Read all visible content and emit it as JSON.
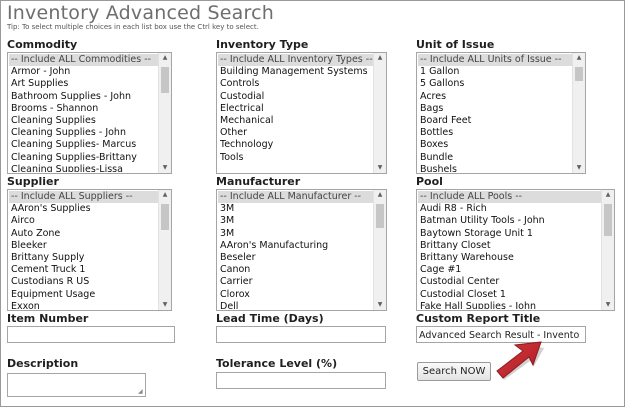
{
  "page": {
    "title": "Inventory Advanced Search",
    "tip": "Tip: To select multiple choices in each list box use the Ctrl key to select."
  },
  "lists": {
    "commodity": {
      "label": "Commodity",
      "options": [
        "-- Include ALL Commodities --",
        "Armor - John",
        "Art Supplies",
        "Bathroom Supplies - John",
        "Brooms - Shannon",
        "Cleaning Supplies",
        "Cleaning Supplies - John",
        "Cleaning Supplies- Marcus",
        "Cleaning Supplies-Brittany",
        "Cleaning Supplies-Lissa"
      ]
    },
    "inventory_type": {
      "label": "Inventory Type",
      "options": [
        "-- Include ALL Inventory Types --",
        "Building Management Systems",
        "Controls",
        "Custodial",
        "Electrical",
        "Mechanical",
        "Other",
        "Technology",
        "Tools"
      ]
    },
    "unit_of_issue": {
      "label": "Unit of Issue",
      "options": [
        "-- Include ALL Units of Issue --",
        "1 Gallon",
        "5 Gallons",
        "Acres",
        "Bags",
        "Board Feet",
        "Bottles",
        "Boxes",
        "Bundle",
        "Bushels"
      ]
    },
    "supplier": {
      "label": "Supplier",
      "options": [
        "-- Include ALL Suppliers --",
        "AAron's Supplies",
        "Airco",
        "Auto Zone",
        "Bleeker",
        "Brittany Supply",
        "Cement Truck 1",
        "Custodians R US",
        "Equipment Usage",
        "Exxon"
      ]
    },
    "manufacturer": {
      "label": "Manufacturer",
      "options": [
        "-- Include ALL Manufacturer --",
        "3M",
        "3M",
        "3M",
        "AAron's Manufacturing",
        "Beseler",
        "Canon",
        "Carrier",
        "Clorox",
        "Dell"
      ]
    },
    "pool": {
      "label": "Pool",
      "options": [
        "-- Include ALL Pools --",
        "Audi R8 - Rich",
        "Batman Utility Tools - John",
        "Baytown Storage Unit 1",
        "Brittany Closet",
        "Brittany Warehouse",
        "Cage #1",
        "Custodial Center",
        "Custodial Closet 1",
        "Fake Hall Supplies - John"
      ]
    }
  },
  "fields": {
    "item_number": {
      "label": "Item Number",
      "value": ""
    },
    "lead_time": {
      "label": "Lead Time (Days)",
      "value": ""
    },
    "custom_report_title": {
      "label": "Custom Report Title",
      "value": "Advanced Search Result - Invento"
    },
    "description": {
      "label": "Description",
      "value": ""
    },
    "tolerance_level": {
      "label": "Tolerance Level (%)",
      "value": ""
    }
  },
  "search_button": {
    "label": "Search NOW"
  },
  "colors": {
    "annotation_arrow": "#c0272d",
    "selected_option_bg": "#dcdcdc",
    "title_text": "#6e6e6e"
  }
}
